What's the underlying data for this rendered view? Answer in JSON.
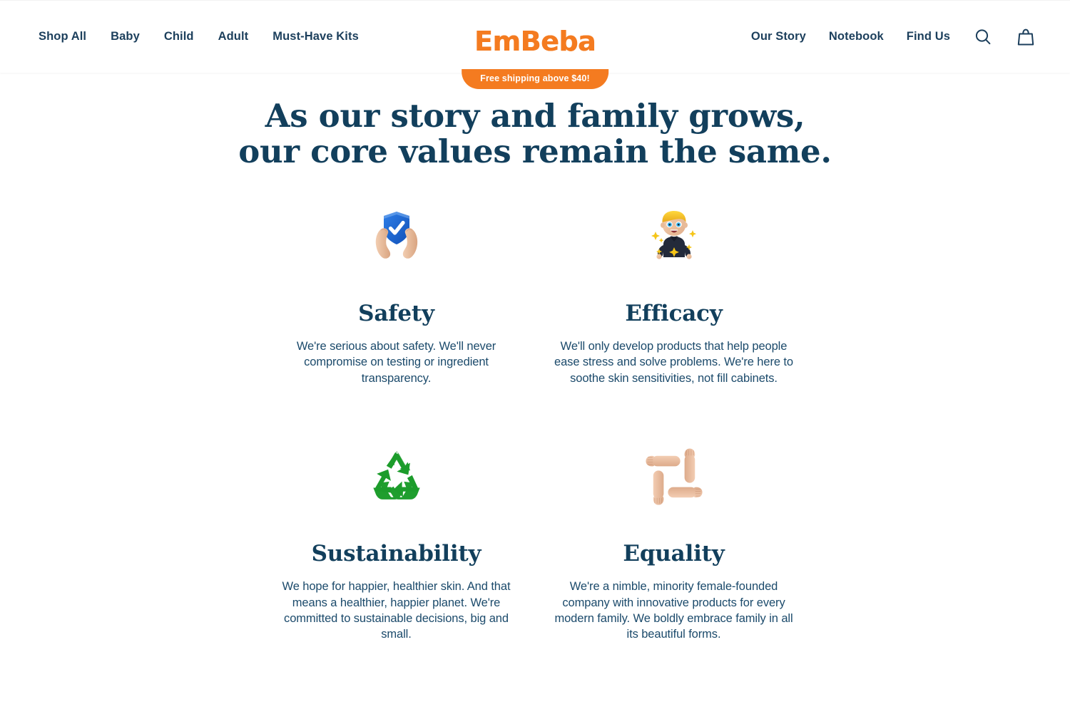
{
  "header": {
    "logo": "EmBeba",
    "shipping_banner": "Free shipping above $40!",
    "nav_left": [
      {
        "label": "Shop All"
      },
      {
        "label": "Baby"
      },
      {
        "label": "Child"
      },
      {
        "label": "Adult"
      },
      {
        "label": "Must-Have Kits"
      }
    ],
    "nav_right": [
      {
        "label": "Our Story"
      },
      {
        "label": "Notebook"
      },
      {
        "label": "Find Us"
      }
    ],
    "icons": {
      "search": "search-icon",
      "bag": "shopping-bag-icon"
    }
  },
  "main": {
    "headline_line1": "As our story and family grows,",
    "headline_line2": "our core values remain the same.",
    "values": [
      {
        "icon": "hands-holding-shield-icon",
        "title": "Safety",
        "description": "We're serious about safety. We'll never compromise on testing or ingredient transparency."
      },
      {
        "icon": "sparkling-child-icon",
        "title": "Efficacy",
        "description": "We'll only develop products that help people ease stress and solve problems. We're here to soothe skin sensitivities, not fill cabinets."
      },
      {
        "icon": "recycling-symbol-icon",
        "title": "Sustainability",
        "description": "We hope for happier, healthier skin. And that means a healthier, happier planet. We're committed to sustainable decisions, big and small."
      },
      {
        "icon": "four-arms-unity-icon",
        "title": "Equality",
        "description": "We're a nimble, minority female-founded company with innovative products for every modern family. We boldly embrace family in all its beautiful forms."
      }
    ]
  },
  "colors": {
    "brand_orange": "#f47b20",
    "navy": "#123f5c",
    "body_navy": "#1b4a6b",
    "shield_blue": "#1f6fe0",
    "recycle_green": "#1f9e2e",
    "skin": "#e8b795"
  }
}
